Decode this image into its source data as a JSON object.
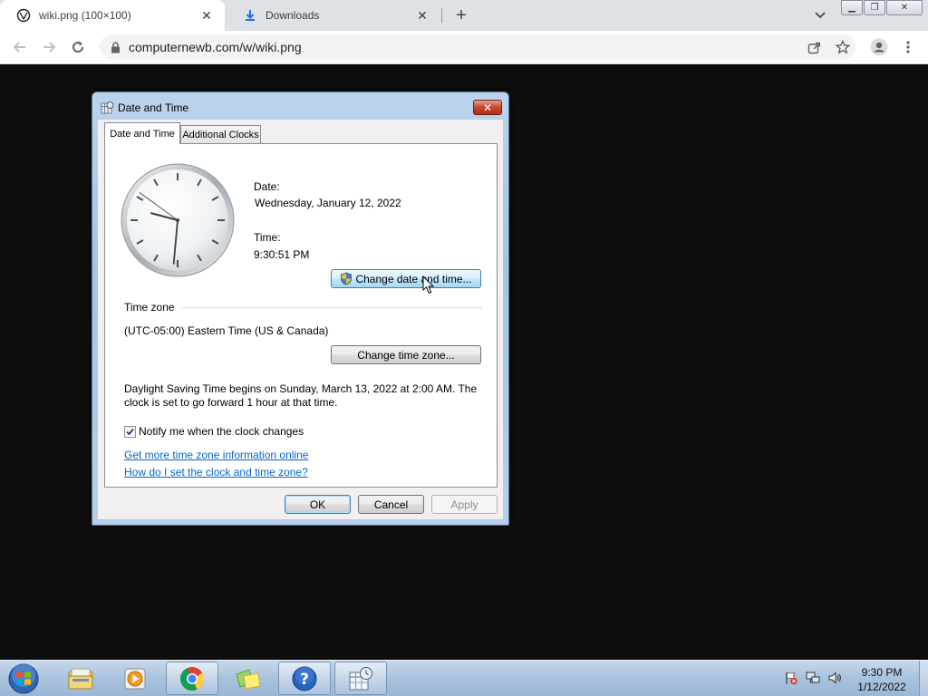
{
  "browser": {
    "tabs": [
      {
        "title": "wiki.png (100×100)",
        "active": true
      },
      {
        "title": "Downloads",
        "active": false
      }
    ],
    "url": "computernewb.com/w/wiki.png"
  },
  "dialog": {
    "title": "Date and Time",
    "tabs": [
      "Date and Time",
      "Additional Clocks"
    ],
    "clock_time": {
      "hours": 9,
      "minutes": 30,
      "seconds": 51
    },
    "date_label": "Date:",
    "date_value": "Wednesday, January 12, 2022",
    "time_label": "Time:",
    "time_value": "9:30:51 PM",
    "change_datetime_button": "Change date and time...",
    "timezone_section_label": "Time zone",
    "timezone_value": "(UTC-05:00) Eastern Time (US & Canada)",
    "change_timezone_button": "Change time zone...",
    "dst_line1": "Daylight Saving Time begins on Sunday, March 13, 2022 at 2:00 AM. The",
    "dst_line2": "clock is set to go forward 1 hour at that time.",
    "notify_checkbox_label": "Notify me when the clock changes",
    "notify_checked": true,
    "link_more_info": "Get more time zone information online",
    "link_how_to": "How do I set the clock and time zone?",
    "ok_button": "OK",
    "cancel_button": "Cancel",
    "apply_button": "Apply"
  },
  "taskbar": {
    "pinned_icons": [
      "windows-explorer-icon",
      "media-player-icon",
      "chrome-icon",
      "sticky-notes-icon",
      "help-icon",
      "date-time-icon"
    ],
    "time": "9:30 PM",
    "date": "1/12/2022"
  },
  "colors": {
    "link": "#0066cc",
    "dialog_frame": "#a9c3e2",
    "taskbar": "#a8c2dd"
  }
}
